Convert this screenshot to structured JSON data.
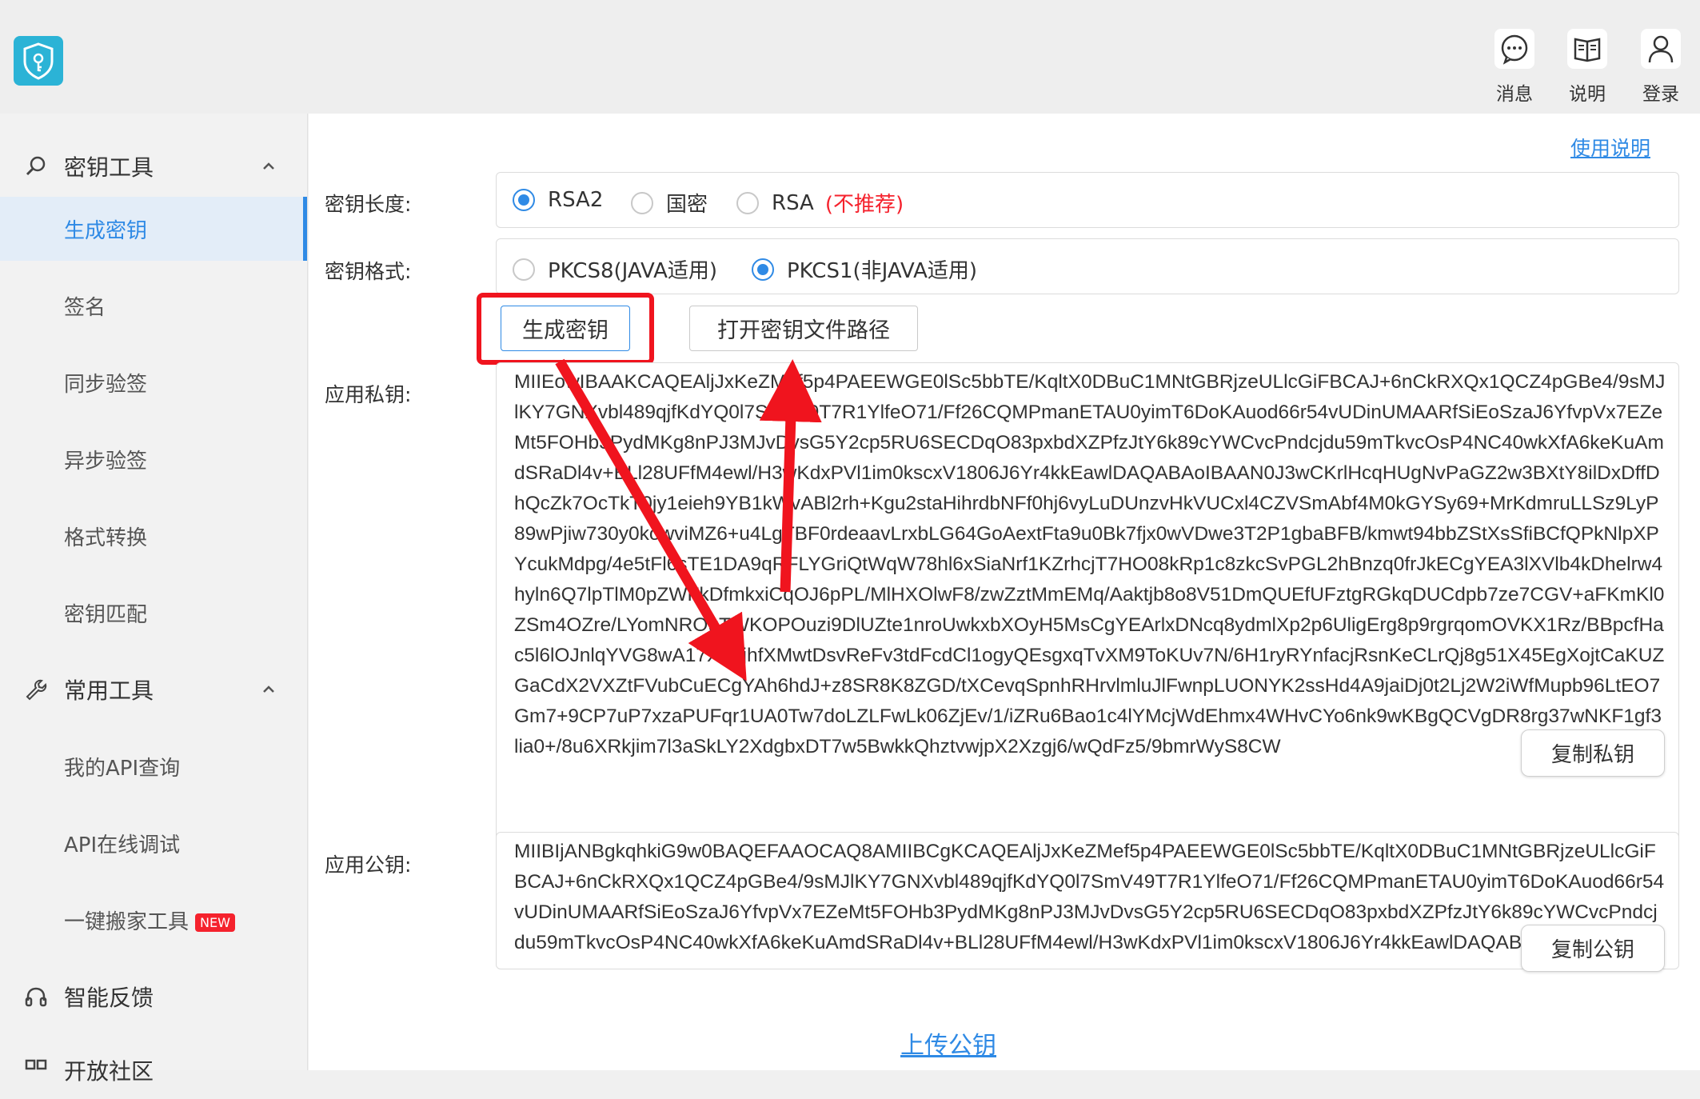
{
  "topbar": {
    "actions": [
      {
        "icon": "message-icon",
        "label": "消息"
      },
      {
        "icon": "book-icon",
        "label": "说明"
      },
      {
        "icon": "user-icon",
        "label": "登录"
      }
    ]
  },
  "sidebar": {
    "group1": {
      "icon": "search-icon",
      "label": "密钥工具"
    },
    "items1": [
      "生成密钥",
      "签名",
      "同步验签",
      "异步验签",
      "格式转换",
      "密钥匹配"
    ],
    "group2": {
      "icon": "wrench-icon",
      "label": "常用工具"
    },
    "items2": [
      "我的API查询",
      "API在线调试",
      "一键搬家工具"
    ],
    "new_badge": "NEW",
    "group3": {
      "icon": "headset-icon",
      "label": "智能反馈"
    },
    "group4": {
      "label": "开放社区"
    }
  },
  "main": {
    "help_link": "使用说明",
    "key_length": {
      "label": "密钥长度:",
      "options": [
        "RSA2",
        "国密",
        "RSA"
      ],
      "selected": "RSA2",
      "warning": "(不推荐)"
    },
    "key_format": {
      "label": "密钥格式:",
      "options": [
        "PKCS8(JAVA适用)",
        "PKCS1(非JAVA适用)"
      ],
      "selected": "PKCS1(非JAVA适用)"
    },
    "generate_button": "生成密钥",
    "open_path_button": "打开密钥文件路径",
    "private_key": {
      "label": "应用私钥:",
      "value": "MIIEowIBAAKCAQEAljJxKeZMef5p4PAEEWGE0lSc5bbTE/KqltX0DBuC1MNtGBRjzeULlcGiFBCAJ+6nCkRXQx1QCZ4pGBe4/9sMJlKY7GNXvbl489qjfKdYQ0l7SmV49T7R1YlfeO71/Ff26CQMPmanETAU0yimT6DoKAuod66r54vUDinUMAARfSiEoSzaJ6YfvpVx7EZeMt5FOHb3PydMKg8nPJ3MJvDvsG5Y2cp5RU6SECDqO83pxbdXZPfzJtY6k89cYWCvcPndcjdu59mTkvcOsP4NC40wkXfA6keKuAmdSRaDl4v+BLl28UFfM4ewl/H3wKdxPVl1im0kscxV1806J6Yr4kkEawlDAQABAoIBAAN0J3wCKrlHcqHUgNvPaGZ2w3BXtY8ilDxDffDhQcZk7OcTkT0jy1eieh9YB1kWvABl2rh+Kgu2staHihrdbNFf0hj6vyLuDUnzvHkVUCxl4CZVSmAbf4M0kGYSy69+MrKdmruLLSz9LyP89wPjiw730y0kowviMZ6+u4LgTBF0rdeaavLrxbLG64GoAextFta9u0Bk7fjx0wVDwe3T2P1gbaBFB/kmwt94bbZStXsSfiBCfQPkNlpXPYcukMdpg/4e5tFl6sTE1DA9qRFLYGriQtWqW78hl6xSiaNrf1KZrhcjT7HO08kRp1c8zkcSvPGL2hBnzq0frJkECgYEA3lXVlb4kDhelrw4hyln6Q7lpTlM0pZWFkDfmkxiCqOJ6pPL/MlHXOlwF8/zwZztMmEMq/Aaktjb8o8V51DmQUEfUFztgRGkqDUCdpb7ze7CGV+aFKmKl0ZSm4OZre/LYomNROuTWKOPOuzi9DlUZte1nroUwkxbXOyH5MsCgYEArlxDNcq8ydmlXp2p6UligErg8p9rgrqomOVKX1Rz/BBpcfHac5l6lOJnlqYVG8wA17XAyjhfXMwtDsvReFv3tdFcdCl1ogyQEsgxqTvXM9ToKUv7N/6H1ryRYnfacjRsnKeCLrQj8g51X45EgXojtCaKUZGaCdX2VXZtFVubCuECgYAh6hdJ+z8SR8K8ZGD/tXCevqSpnhRHrvlmluJlFwnpLUONYK2ssHd4A9jaiDj0t2Lj2W2iWfMupb96LtEO7Gm7+9CP7uP7xzaPUFqr1UA0Tw7doLZLFwLk06ZjEv/1/iZRu6Bao1c4lYMcjWdEhmx4WHvCYo6nk9wKBgQCVgDR8rg37wNKF1gf3lia0+/8u6XRkjim7l3aSkLY2XdgbxDT7w5BwkkQhztvwjpX2Xzgj6/wQdFz5/9bmrWyS8CW"
    },
    "copy_private_button": "复制私钥",
    "public_key": {
      "label": "应用公钥:",
      "value": "MIIBIjANBgkqhkiG9w0BAQEFAAOCAQ8AMIIBCgKCAQEAljJxKeZMef5p4PAEEWGE0lSc5bbTE/KqltX0DBuC1MNtGBRjzeULlcGiFBCAJ+6nCkRXQx1QCZ4pGBe4/9sMJlKY7GNXvbl489qjfKdYQ0l7SmV49T7R1YlfeO71/Ff26CQMPmanETAU0yimT6DoKAuod66r54vUDinUMAARfSiEoSzaJ6YfvpVx7EZeMt5FOHb3PydMKg8nPJ3MJvDvsG5Y2cp5RU6SECDqO83pxbdXZPfzJtY6k89cYWCvcPndcjdu59mTkvcOsP4NC40wkXfA6keKuAmdSRaDl4v+BLl28UFfM4ewl/H3wKdxPVl1im0kscxV1806J6Yr4kkEawlDAQAB"
    },
    "copy_public_button": "复制公钥",
    "upload_link": "上传公钥"
  },
  "colors": {
    "accent": "#2f8ae5",
    "highlight": "#f0141e",
    "logo": "#2bb3d6"
  }
}
